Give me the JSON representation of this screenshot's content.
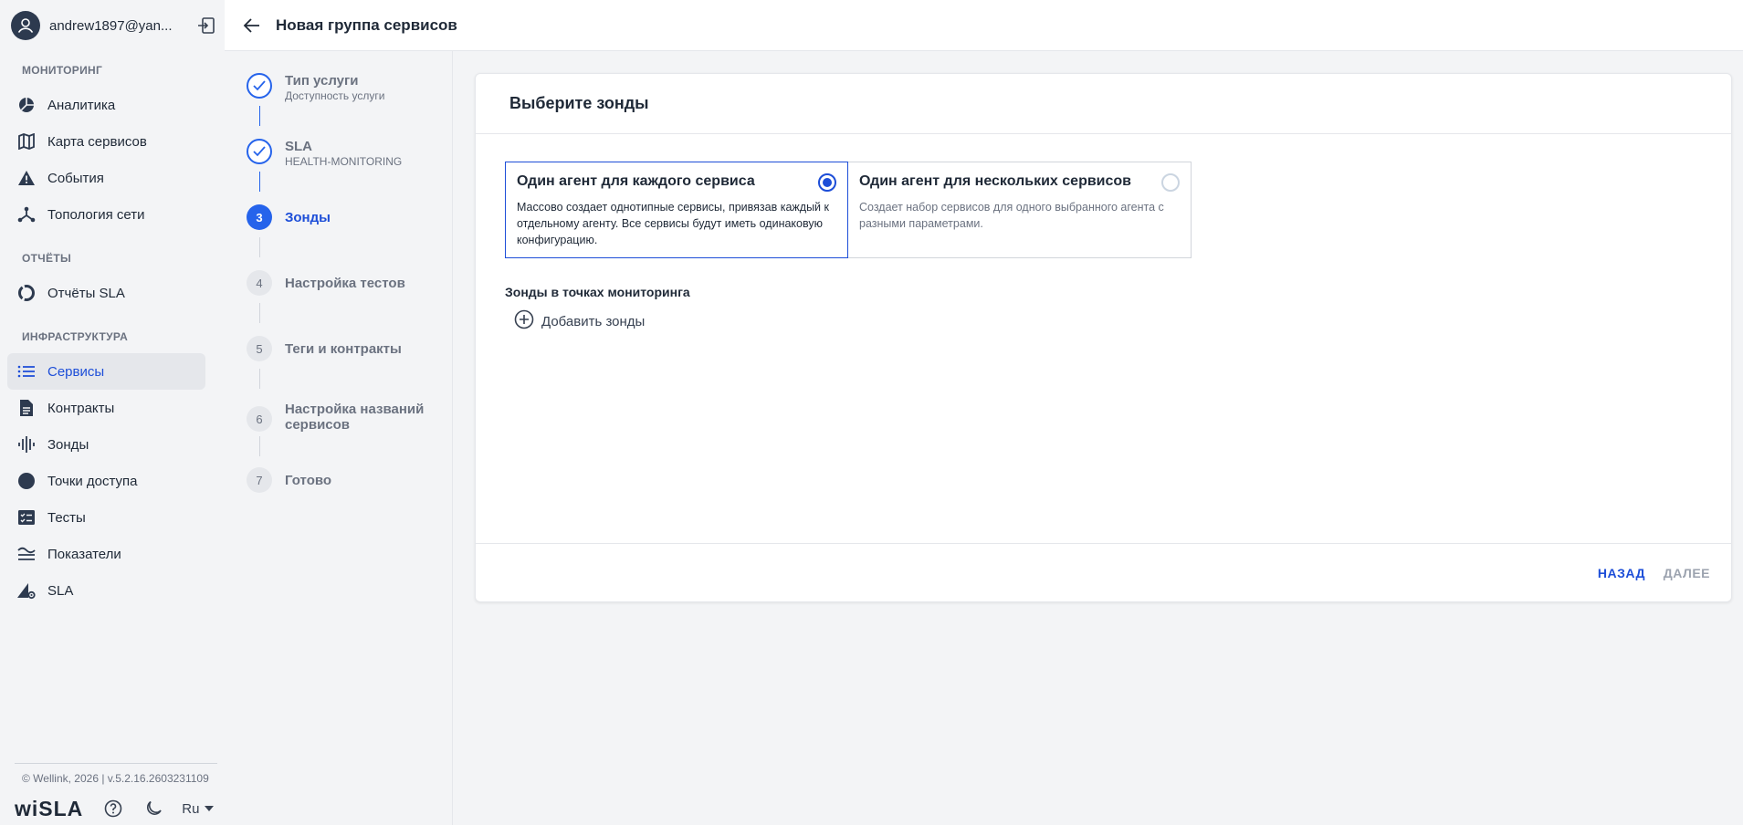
{
  "user": {
    "email": "andrew1897@yan..."
  },
  "sidebar": {
    "sections": [
      {
        "title": "МОНИТОРИНГ",
        "items": [
          {
            "label": "Аналитика",
            "icon": "pie-chart-icon"
          },
          {
            "label": "Карта сервисов",
            "icon": "map-icon"
          },
          {
            "label": "События",
            "icon": "warning-icon"
          },
          {
            "label": "Топология сети",
            "icon": "topology-icon"
          }
        ]
      },
      {
        "title": "ОТЧЁТЫ",
        "items": [
          {
            "label": "Отчёты SLA",
            "icon": "ring-chart-icon"
          }
        ]
      },
      {
        "title": "ИНФРАСТРУКТУРА",
        "items": [
          {
            "label": "Сервисы",
            "icon": "list-icon",
            "active": true
          },
          {
            "label": "Контракты",
            "icon": "document-icon"
          },
          {
            "label": "Зонды",
            "icon": "signal-bars-icon"
          },
          {
            "label": "Точки доступа",
            "icon": "circle-icon"
          },
          {
            "label": "Тесты",
            "icon": "checklist-icon"
          },
          {
            "label": "Показатели",
            "icon": "lines-icon"
          },
          {
            "label": "SLA",
            "icon": "sla-gear-icon"
          }
        ]
      }
    ],
    "copyright": "© Wellink, 2026 | v.5.2.16.2603231109",
    "logo": "wiSLA",
    "language": "Ru"
  },
  "header": {
    "title": "Новая группа сервисов"
  },
  "stepper": {
    "steps": [
      {
        "number": "1",
        "title": "Тип услуги",
        "subtitle": "Доступность услуги",
        "state": "done"
      },
      {
        "number": "2",
        "title": "SLA",
        "subtitle": "HEALTH-MONITORING",
        "state": "done"
      },
      {
        "number": "3",
        "title": "Зонды",
        "subtitle": "",
        "state": "current"
      },
      {
        "number": "4",
        "title": "Настройка тестов",
        "subtitle": "",
        "state": "todo"
      },
      {
        "number": "5",
        "title": "Теги и контракты",
        "subtitle": "",
        "state": "todo"
      },
      {
        "number": "6",
        "title": "Настройка названий сервисов",
        "subtitle": "",
        "state": "todo"
      },
      {
        "number": "7",
        "title": "Готово",
        "subtitle": "",
        "state": "todo"
      }
    ]
  },
  "card": {
    "title": "Выберите зонды",
    "options": [
      {
        "title": "Один агент для каждого сервиса",
        "description": "Массово создает однотипные сервисы, привязав каждый к отдельному агенту. Все сервисы будут иметь одинаковую конфигурацию.",
        "selected": true
      },
      {
        "title": "Один агент для нескольких сервисов",
        "description": "Создает набор сервисов для одного выбранного агента с разными параметрами.",
        "selected": false
      }
    ],
    "zones_label": "Зонды в точках мониторинга",
    "add_zones_label": "Добавить зонды",
    "back_label": "НАЗАД",
    "next_label": "ДАЛЕЕ"
  },
  "colors": {
    "accent": "#1d4ed8",
    "active_bg": "#e5e7eb",
    "disabled": "#9ca3af"
  }
}
